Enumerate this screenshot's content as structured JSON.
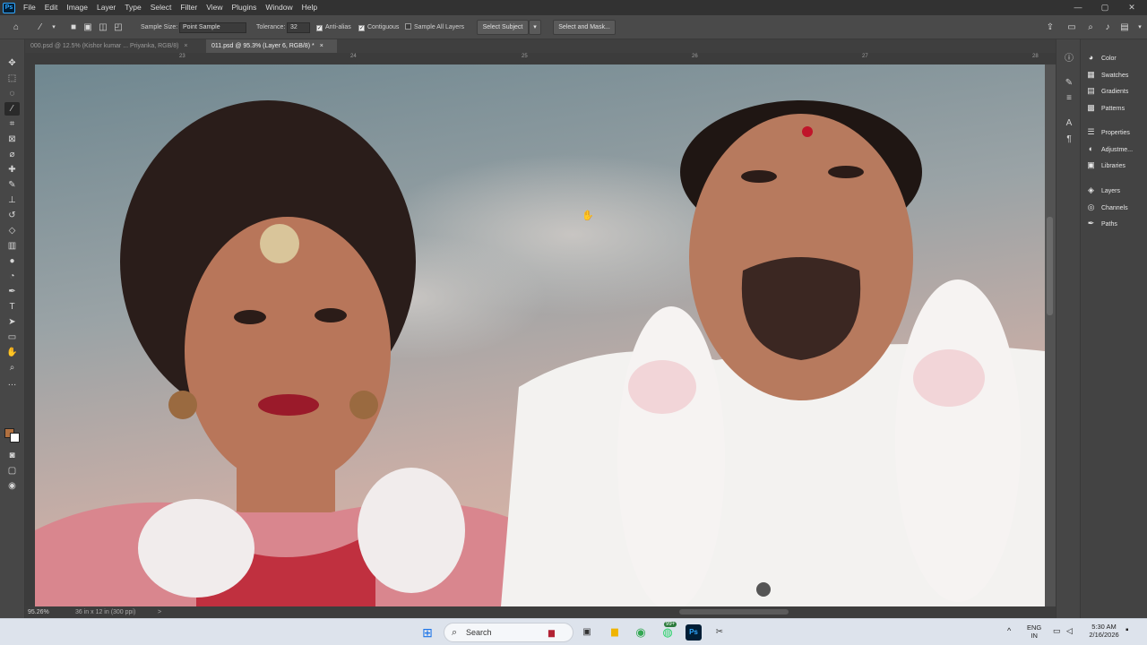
{
  "app": {
    "logo": "Ps"
  },
  "menu": [
    "File",
    "Edit",
    "Image",
    "Layer",
    "Type",
    "Select",
    "Filter",
    "View",
    "Plugins",
    "Window",
    "Help"
  ],
  "window_controls": {
    "minimize": "—",
    "restore": "▢",
    "close": "✕"
  },
  "options": {
    "sample_size_label": "Sample Size:",
    "sample_size_value": "Point Sample",
    "tolerance_label": "Tolerance:",
    "tolerance_value": "32",
    "anti_alias": "Anti-alias",
    "contiguous": "Contiguous",
    "sample_all_layers": "Sample All Layers",
    "select_subject": "Select Subject",
    "select_and_mask": "Select and Mask..."
  },
  "tabs": [
    {
      "label": "000.psd @ 12.5% (Kishor kumar ... Priyanka, RGB/8)",
      "close": "×"
    },
    {
      "label": "011.psd @ 95.3% (Layer 6, RGB/8) *",
      "close": "×"
    }
  ],
  "ruler": {
    "marks": [
      "23",
      "24",
      "25",
      "26",
      "27",
      "28"
    ]
  },
  "status": {
    "zoom": "95.26%",
    "doc_info": "36 in x 12 in (300 ppi)",
    "arrow": ">"
  },
  "panels": [
    {
      "label": "Color",
      "icon": "color-icon"
    },
    {
      "label": "Swatches",
      "icon": "swatches-icon"
    },
    {
      "label": "Gradients",
      "icon": "gradients-icon"
    },
    {
      "label": "Patterns",
      "icon": "patterns-icon"
    },
    {
      "label": "Properties",
      "icon": "properties-icon"
    },
    {
      "label": "Adjustme...",
      "icon": "adjustments-icon"
    },
    {
      "label": "Libraries",
      "icon": "libraries-icon"
    },
    {
      "label": "Layers",
      "icon": "layers-icon"
    },
    {
      "label": "Channels",
      "icon": "channels-icon"
    },
    {
      "label": "Paths",
      "icon": "paths-icon"
    }
  ],
  "taskbar": {
    "search_placeholder": "Search",
    "badge": "99+",
    "lang_top": "ENG",
    "lang_bottom": "IN",
    "time": "5:30 AM",
    "date": "2/16/2026"
  },
  "colors": {
    "accent": "#31a8ff",
    "foreground_swatch": "#b07040",
    "background_swatch": "#ffffff"
  }
}
